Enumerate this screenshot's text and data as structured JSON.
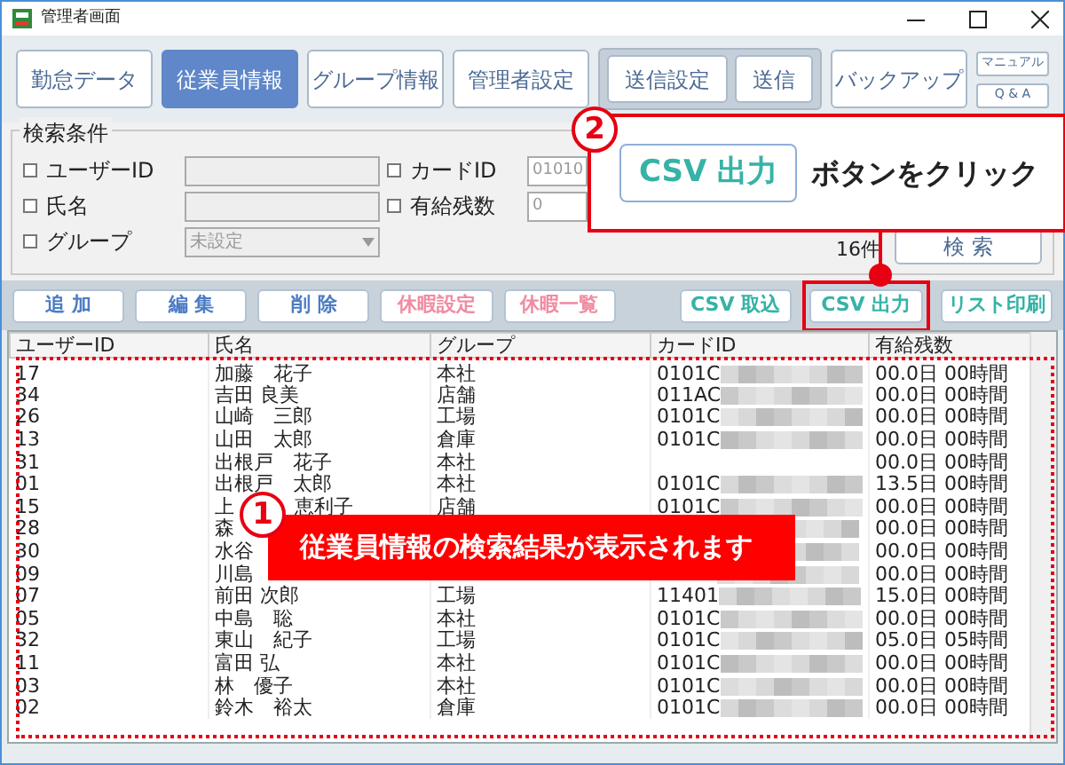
{
  "window": {
    "title": "管理者画面"
  },
  "main_tabs": [
    {
      "label": "勤怠データ",
      "selected": false
    },
    {
      "label": "従業員情報",
      "selected": true
    },
    {
      "label": "グループ情報",
      "selected": false
    },
    {
      "label": "管理者設定",
      "selected": false
    }
  ],
  "send_group": [
    {
      "label": "送信設定",
      "selected": false
    },
    {
      "label": "送信",
      "selected": false
    }
  ],
  "backup_button": "バックアップ",
  "help_links": [
    "マニュアル",
    "Q & A"
  ],
  "search": {
    "legend": "検索条件",
    "left_fields": [
      {
        "kind": "text",
        "label": "ユーザーID",
        "checked": false,
        "disabled": true
      },
      {
        "kind": "text",
        "label": "氏名",
        "checked": false,
        "disabled": true
      },
      {
        "kind": "select",
        "label": "グループ",
        "checked": false,
        "disabled": true,
        "value": "未設定"
      }
    ],
    "right_fields": [
      {
        "kind": "text",
        "label": "カードID",
        "checked": false,
        "disabled": false,
        "value": "01010"
      },
      {
        "kind": "text",
        "label": "有給残数",
        "checked": false,
        "disabled": false,
        "value": "0"
      }
    ],
    "count": "16件",
    "search_button": "検 索"
  },
  "actions": [
    {
      "label": "追 加",
      "kind": "edit",
      "highlighted": false
    },
    {
      "label": "編 集",
      "kind": "edit",
      "highlighted": false
    },
    {
      "label": "削 除",
      "kind": "edit",
      "highlighted": false
    },
    {
      "label": "休暇設定",
      "kind": "leave",
      "highlighted": false
    },
    {
      "label": "休暇一覧",
      "kind": "leave",
      "highlighted": false
    },
    {
      "label": "CSV 取込",
      "kind": "csv",
      "highlighted": false
    },
    {
      "label": "CSV 出力",
      "kind": "csv",
      "highlighted": true
    },
    {
      "label": "リスト印刷",
      "kind": "csv",
      "highlighted": false
    }
  ],
  "table": {
    "columns": [
      "ユーザーID",
      "氏名",
      "グループ",
      "カードID",
      "有給残数"
    ],
    "rows": [
      {
        "user_id": "17",
        "name": "加藤　花子",
        "group": "本社",
        "card_prefix": "0101C",
        "masked": true,
        "leave": "00.0日 00時間"
      },
      {
        "user_id": "34",
        "name": "吉田 良美",
        "group": "店舗",
        "card_prefix": "011AC",
        "masked": true,
        "leave": "00.0日 00時間"
      },
      {
        "user_id": "26",
        "name": "山崎　三郎",
        "group": "工場",
        "card_prefix": "0101C",
        "masked": true,
        "leave": "00.0日 00時間"
      },
      {
        "user_id": "13",
        "name": "山田　太郎",
        "group": "倉庫",
        "card_prefix": "0101C",
        "masked": true,
        "leave": "00.0日 00時間"
      },
      {
        "user_id": "31",
        "name": "出根戸　花子",
        "group": "本社",
        "masked": false,
        "leave": "00.0日 00時間"
      },
      {
        "user_id": "01",
        "name": "出根戸　太郎",
        "group": "本社",
        "card_prefix": "0101C",
        "masked": true,
        "leave": "13.5日 00時間"
      },
      {
        "user_id": "15",
        "name": "上",
        "name_end": "恵利子",
        "group": "店舗",
        "card_prefix": "0101C",
        "masked": true,
        "leave": "00.0日 00時間"
      },
      {
        "user_id": "28",
        "name": "森",
        "masked": true,
        "leave": "00.0日 00時間"
      },
      {
        "user_id": "30",
        "name": "水谷",
        "masked": true,
        "leave": "00.0日 00時間"
      },
      {
        "user_id": "09",
        "name": "川島",
        "masked": true,
        "leave": "00.0日 00時間"
      },
      {
        "user_id": "07",
        "name": "前田 次郎",
        "group": "工場",
        "card_prefix": "11401",
        "masked": true,
        "leave": "15.0日 00時間"
      },
      {
        "user_id": "05",
        "name": "中島　聡",
        "group": "本社",
        "card_prefix": "0101C",
        "masked": true,
        "leave": "00.0日 00時間"
      },
      {
        "user_id": "32",
        "name": "東山　紀子",
        "group": "工場",
        "card_prefix": "0101C",
        "masked": true,
        "leave": "05.0日 05時間"
      },
      {
        "user_id": "11",
        "name": "富田 弘",
        "group": "本社",
        "card_prefix": "0101C",
        "masked": true,
        "leave": "00.0日 00時間"
      },
      {
        "user_id": "03",
        "name": "林　優子",
        "group": "本社",
        "card_prefix": "0101C",
        "masked": true,
        "leave": "00.0日 00時間"
      },
      {
        "user_id": "02",
        "name": "鈴木　裕太",
        "group": "倉庫",
        "card_prefix": "0101C",
        "masked": true,
        "leave": "00.0日 00時間"
      }
    ]
  },
  "callouts": [
    {
      "number": "2",
      "button_label": "CSV 出力",
      "text": "ボタンをクリック"
    },
    {
      "number": "1",
      "text": "従業員情報の検索結果が表示されます"
    }
  ]
}
